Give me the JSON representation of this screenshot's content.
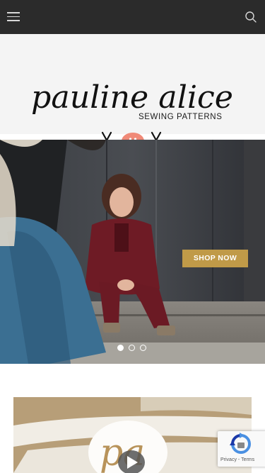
{
  "header": {
    "menu_icon": "hamburger-menu-icon",
    "search_icon": "search-icon",
    "bg_color": "#2b2b2b"
  },
  "logo": {
    "script_text": "pauline alice",
    "subtitle": "SEWING PATTERNS",
    "marks": [
      "scissors-icon",
      "button-icon",
      "scissors-icon"
    ],
    "button_color": "#f08a78"
  },
  "hero": {
    "cta_label": "SHOP NOW",
    "cta_color": "#c09a48",
    "slides_total": 3,
    "active_slide": 1
  },
  "promo": {
    "badge_text": "pa",
    "play_icon": "play-icon"
  },
  "recaptcha": {
    "privacy_label": "Privacy",
    "separator": " - ",
    "terms_label": "Terms"
  }
}
